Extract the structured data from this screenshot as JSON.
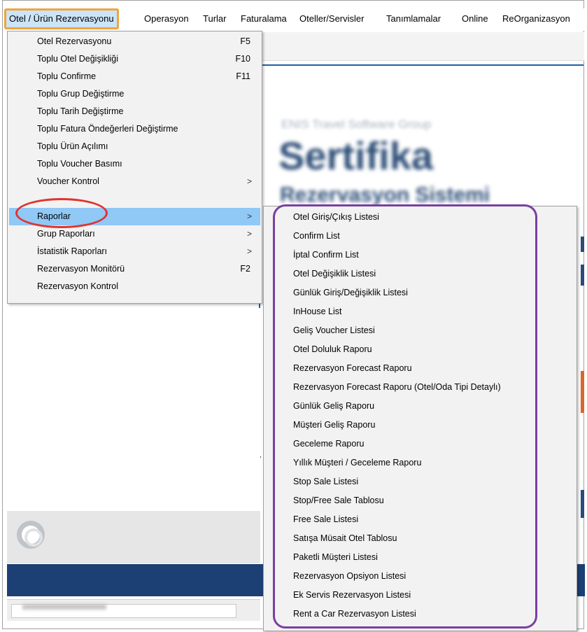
{
  "menubar": {
    "items": [
      {
        "label": "Otel / Ürün Rezervasyonu"
      },
      {
        "label": "Operasyon"
      },
      {
        "label": "Turlar"
      },
      {
        "label": "Faturalama"
      },
      {
        "label": "Oteller/Servisler"
      },
      {
        "label": "Tanımlamalar"
      },
      {
        "label": "Online"
      },
      {
        "label": "ReOrganizasyon"
      }
    ]
  },
  "background": {
    "logo_subtitle": "ENIS Travel Software Group",
    "logo_title": "Sertifika",
    "logo_subtitle2": "Rezervasyon Sistemi"
  },
  "main_menu": {
    "items": [
      {
        "label": "Otel Rezervasyonu",
        "shortcut": "F5"
      },
      {
        "label": "Toplu Otel Değişikliği",
        "shortcut": "F10"
      },
      {
        "label": "Toplu Confirme",
        "shortcut": "F11"
      },
      {
        "label": "Toplu Grup Değiştirme"
      },
      {
        "label": "Toplu Tarih Değiştirme"
      },
      {
        "label": "Toplu Fatura Öndeğerleri  Değiştirme"
      },
      {
        "label": "Toplu Ürün Açılımı"
      },
      {
        "label": "Toplu Voucher Basımı"
      },
      {
        "label": "Voucher Kontrol",
        "arrow": ">"
      },
      {
        "label": "Raporlar",
        "arrow": ">"
      },
      {
        "label": "Grup Raporları",
        "arrow": ">"
      },
      {
        "label": "İstatistik Raporları",
        "arrow": ">"
      },
      {
        "label": "Rezervasyon Monitörü",
        "shortcut": "F2"
      },
      {
        "label": "Rezervasyon Kontrol"
      }
    ]
  },
  "reports_submenu": {
    "items": [
      {
        "label": "Otel Giriş/Çıkış Listesi"
      },
      {
        "label": "Confirm List"
      },
      {
        "label": "İptal Confirm List"
      },
      {
        "label": "Otel Değişiklik Listesi"
      },
      {
        "label": "Günlük Giriş/Değişiklik Listesi"
      },
      {
        "label": "InHouse List"
      },
      {
        "label": "Geliş Voucher Listesi"
      },
      {
        "label": "Otel Doluluk Raporu"
      },
      {
        "label": "Rezervasyon Forecast Raporu"
      },
      {
        "label": "Rezervasyon Forecast Raporu (Otel/Oda Tipi Detaylı)"
      },
      {
        "label": "Günlük Geliş Raporu"
      },
      {
        "label": "Müşteri Geliş Raporu"
      },
      {
        "label": "Geceleme Raporu"
      },
      {
        "label": "Yıllık Müşteri / Geceleme Raporu"
      },
      {
        "label": "Stop Sale Listesi"
      },
      {
        "label": "Stop/Free Sale Tablosu"
      },
      {
        "label": "Free Sale Listesi"
      },
      {
        "label": "Satışa Müsait Otel Tablosu"
      },
      {
        "label": "Paketli Müşteri Listesi"
      },
      {
        "label": "Rezervasyon Opsiyon Listesi"
      },
      {
        "label": "Ek Servis Rezervasyon Listesi"
      },
      {
        "label": "Rent a Car Rezervasyon Listesi"
      }
    ]
  },
  "colors": {
    "highlight_orange": "#f2a43a",
    "ellipse_red": "#e0342f",
    "box_purple": "#7b3fa0",
    "menu_hover": "#90c8f6",
    "navy": "#1c3f74"
  }
}
